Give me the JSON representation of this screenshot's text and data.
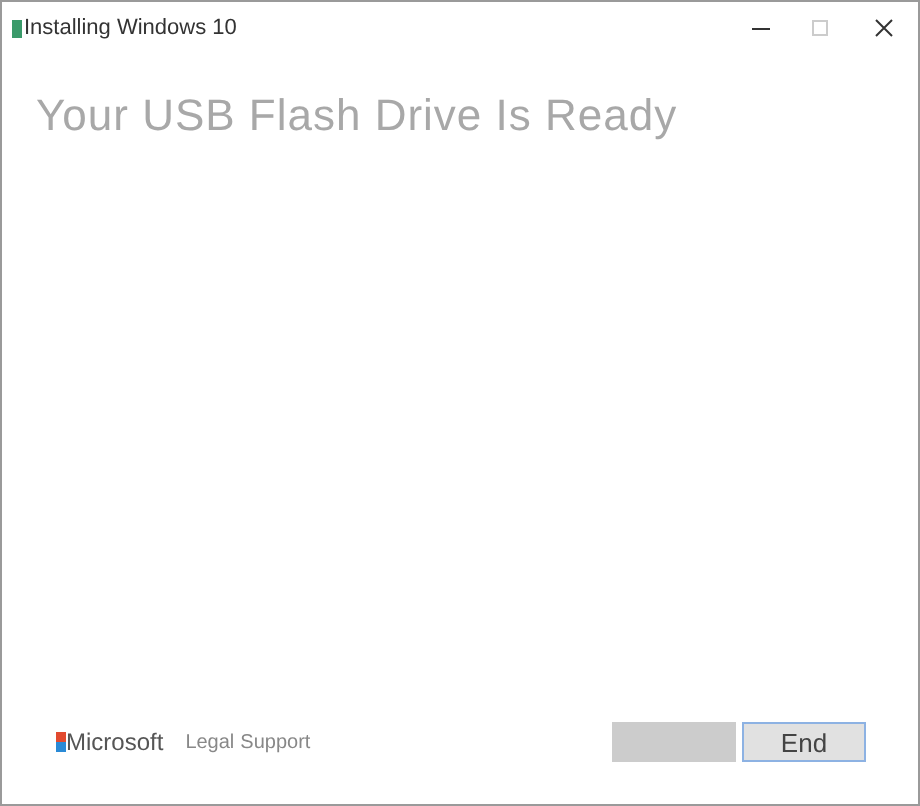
{
  "window": {
    "title": "Installing Windows 10"
  },
  "heading": "Your USB Flash Drive Is Ready",
  "footer": {
    "brand": "Microsoft",
    "links": [
      "Legal",
      "Support"
    ]
  },
  "buttons": [
    {
      "disabled": true
    },
    {
      "label": "End",
      "disabled": false
    }
  ]
}
